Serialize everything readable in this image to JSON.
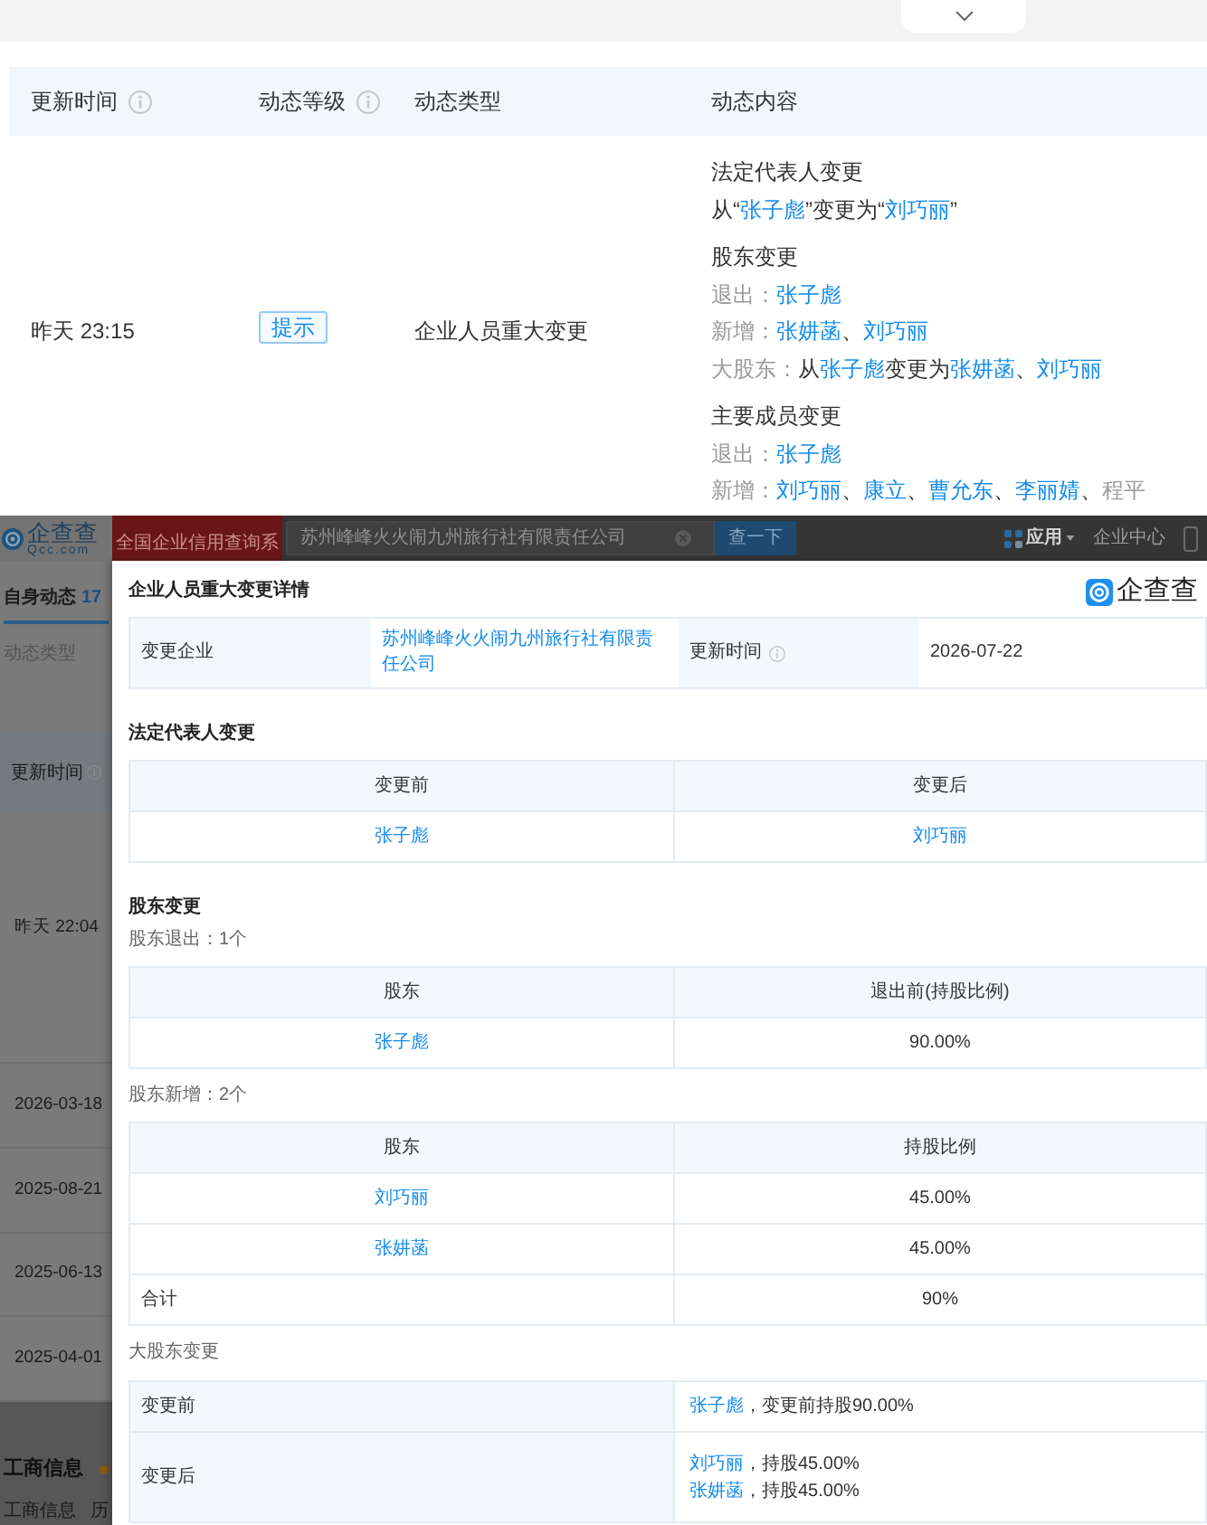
{
  "dynamics_table": {
    "columns": [
      {
        "label": "更新时间",
        "info_icon": true
      },
      {
        "label": "动态等级",
        "info_icon": true
      },
      {
        "label": "动态类型",
        "info_icon": false
      },
      {
        "label": "动态内容",
        "info_icon": false
      }
    ],
    "rows": [
      {
        "time": "昨天 23:15",
        "grade_badge": "提示",
        "type": "企业人员重大变更",
        "content": [
          {
            "title": "法定代表人变更",
            "lines": [
              [
                {
                  "kind": "text",
                  "text": "从“"
                },
                {
                  "kind": "link",
                  "text": "张子彪"
                },
                {
                  "kind": "text",
                  "text": "”变更为“"
                },
                {
                  "kind": "link",
                  "text": "刘巧丽"
                },
                {
                  "kind": "text",
                  "text": "”"
                }
              ]
            ]
          },
          {
            "title": "股东变更",
            "lines": [
              [
                {
                  "kind": "label",
                  "text": "退出："
                },
                {
                  "kind": "link",
                  "text": "张子彪"
                }
              ],
              [
                {
                  "kind": "label",
                  "text": "新增："
                },
                {
                  "kind": "link",
                  "text": "张妌菡"
                },
                {
                  "kind": "text",
                  "text": "、"
                },
                {
                  "kind": "link",
                  "text": "刘巧丽"
                }
              ],
              [
                {
                  "kind": "label",
                  "text": "大股东："
                },
                {
                  "kind": "text",
                  "text": "从"
                },
                {
                  "kind": "link",
                  "text": "张子彪"
                },
                {
                  "kind": "text",
                  "text": "变更为"
                },
                {
                  "kind": "link",
                  "text": "张妌菡"
                },
                {
                  "kind": "text",
                  "text": "、"
                },
                {
                  "kind": "link",
                  "text": "刘巧丽"
                }
              ]
            ]
          },
          {
            "title": "主要成员变更",
            "lines": [
              [
                {
                  "kind": "label",
                  "text": "退出："
                },
                {
                  "kind": "link",
                  "text": "张子彪"
                }
              ],
              [
                {
                  "kind": "label",
                  "text": "新增："
                },
                {
                  "kind": "link",
                  "text": "刘巧丽"
                },
                {
                  "kind": "text",
                  "text": "、"
                },
                {
                  "kind": "link",
                  "text": "康立"
                },
                {
                  "kind": "text",
                  "text": "、"
                },
                {
                  "kind": "link",
                  "text": "曹允东"
                },
                {
                  "kind": "text",
                  "text": "、"
                },
                {
                  "kind": "link",
                  "text": "李丽婧"
                },
                {
                  "kind": "text",
                  "text": "、"
                },
                {
                  "kind": "label",
                  "text": "程平"
                }
              ]
            ]
          }
        ]
      }
    ]
  },
  "background_page": {
    "header": {
      "logo_text": "企查查",
      "logo_domain": "Qcc.com",
      "banner": "全国企业信用查询系",
      "search_value": "苏州峰峰火火闹九州旅行社有限责任公司",
      "search_button": "查一下",
      "nav": [
        {
          "label": "应用",
          "kind": "menu"
        },
        {
          "label": "企业中心",
          "kind": "link"
        }
      ]
    },
    "sidebar": {
      "tab": {
        "label": "自身动态",
        "count": "17",
        "selected": true
      },
      "filter": "动态类型",
      "column": {
        "label": "更新时间",
        "info_icon": true
      },
      "times": [
        "昨天 22:04",
        "2026-03-18",
        "2025-08-21",
        "2025-06-13",
        "2025-04-01"
      ],
      "section": "工商信息",
      "subtabs": [
        "工商信息",
        "历"
      ]
    }
  },
  "modal": {
    "title": "企业人员重大变更详情",
    "brand": "企查查",
    "summary": [
      {
        "label": "变更企业",
        "value": "苏州峰峰火火闹九州旅行社有限责任公司",
        "kind": "link",
        "info_icon": false
      },
      {
        "label": "更新时间",
        "value": "2026-07-22",
        "kind": "text",
        "info_icon": true
      }
    ],
    "sections": [
      {
        "title": "法定代表人变更",
        "blocks": [
          {
            "kind": "table",
            "columns": [
              "变更前",
              "变更后"
            ],
            "rows": [
              {
                "kind": "data",
                "cells": [
                  {
                    "kind": "link",
                    "text": "张子彪"
                  },
                  {
                    "kind": "link",
                    "text": "刘巧丽"
                  }
                ]
              }
            ]
          }
        ]
      },
      {
        "title": "股东变更",
        "blocks": [
          {
            "kind": "caption",
            "text": "股东退出：1个"
          },
          {
            "kind": "table",
            "columns": [
              "股东",
              "退出前(持股比例)"
            ],
            "rows": [
              {
                "kind": "data",
                "cells": [
                  {
                    "kind": "link",
                    "text": "张子彪"
                  },
                  {
                    "kind": "text",
                    "text": "90.00%"
                  }
                ]
              }
            ]
          },
          {
            "kind": "caption",
            "text": "股东新增：2个"
          },
          {
            "kind": "table",
            "columns": [
              "股东",
              "持股比例"
            ],
            "rows": [
              {
                "kind": "data",
                "cells": [
                  {
                    "kind": "link",
                    "text": "刘巧丽"
                  },
                  {
                    "kind": "text",
                    "text": "45.00%"
                  }
                ]
              },
              {
                "kind": "data",
                "cells": [
                  {
                    "kind": "link",
                    "text": "张妌菡"
                  },
                  {
                    "kind": "text",
                    "text": "45.00%"
                  }
                ]
              },
              {
                "kind": "total",
                "cells": [
                  {
                    "kind": "text",
                    "text": "合计"
                  },
                  {
                    "kind": "text",
                    "text": "90%"
                  }
                ]
              }
            ]
          },
          {
            "kind": "caption",
            "text": "大股东变更"
          },
          {
            "kind": "pairs",
            "rows": [
              {
                "label": "变更前",
                "entries": [
                  [
                    {
                      "kind": "link",
                      "text": "张子彪"
                    },
                    {
                      "kind": "text",
                      "text": "，变更前持股90.00%"
                    }
                  ]
                ]
              },
              {
                "label": "变更后",
                "entries": [
                  [
                    {
                      "kind": "link",
                      "text": "刘巧丽"
                    },
                    {
                      "kind": "text",
                      "text": "，持股45.00%"
                    }
                  ],
                  [
                    {
                      "kind": "link",
                      "text": "张妌菡"
                    },
                    {
                      "kind": "text",
                      "text": "，持股45.00%"
                    }
                  ]
                ]
              }
            ]
          }
        ]
      }
    ]
  }
}
